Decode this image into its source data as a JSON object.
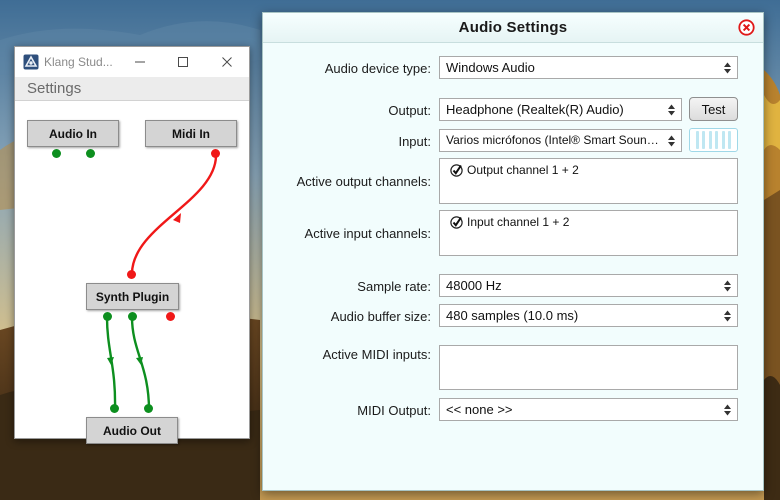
{
  "colors": {
    "accent_close": "#e01818",
    "wire_midi": "#f01818",
    "wire_audio": "#0d8f1f",
    "dialog_bg": "#f2fdfd"
  },
  "klang_window": {
    "title": "Klang Stud...",
    "icons": {
      "app": "klang-app-icon",
      "minimize": "minimize-icon",
      "maximize": "maximize-icon",
      "close": "close-icon"
    },
    "menu": [
      "Settings"
    ],
    "nodes": {
      "audio_in": "Audio In",
      "midi_in": "Midi In",
      "synth_plugin": "Synth Plugin",
      "audio_out": "Audio Out"
    }
  },
  "audio_settings": {
    "title": "Audio Settings",
    "close_icon": "close-circle-icon",
    "device_type": {
      "label": "Audio device type:",
      "value": "Windows Audio"
    },
    "output": {
      "label": "Output:",
      "value": "Headphone (Realtek(R) Audio)"
    },
    "test_button": "Test",
    "input": {
      "label": "Input:",
      "value": "Varios micrófonos (Intel® Smart Sound Technology para micrófonos digitales)",
      "value_display": "Varios micrófonos (Intel® Smart Sound..."
    },
    "active_output": {
      "label": "Active output channels:",
      "items": [
        "Output channel 1 + 2"
      ]
    },
    "active_input": {
      "label": "Active input channels:",
      "items": [
        "Input channel 1 + 2"
      ]
    },
    "sample_rate": {
      "label": "Sample rate:",
      "value": "48000 Hz"
    },
    "buffer_size": {
      "label": "Audio buffer size:",
      "value": "480 samples (10.0 ms)"
    },
    "midi_inputs": {
      "label": "Active MIDI inputs:",
      "items": []
    },
    "midi_output": {
      "label": "MIDI Output:",
      "value": "<< none >>"
    }
  }
}
